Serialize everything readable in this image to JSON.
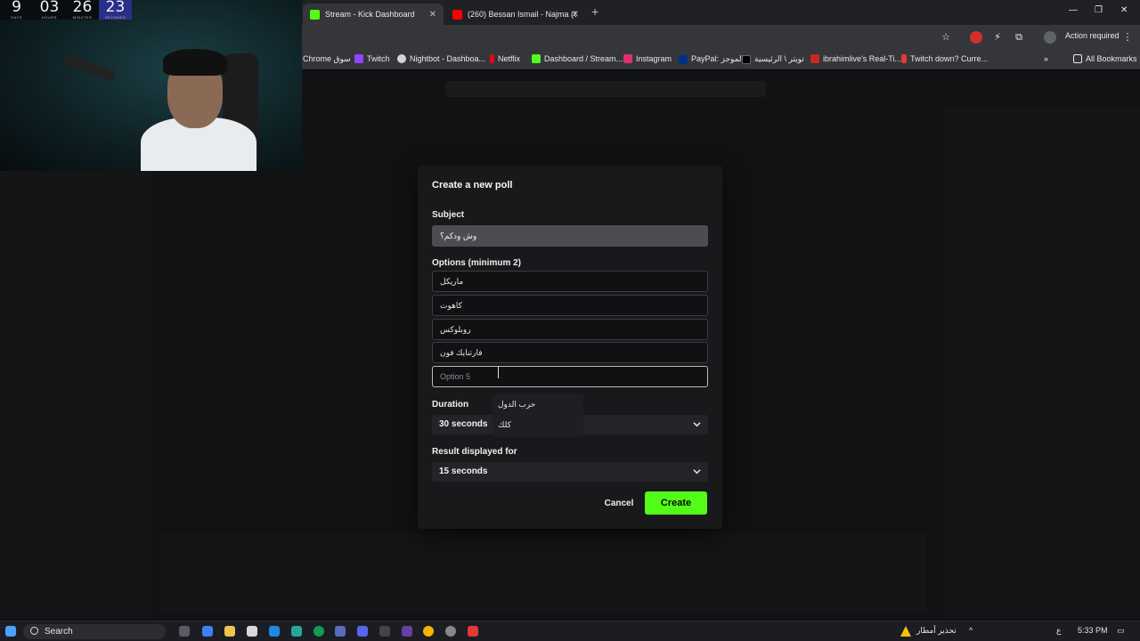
{
  "browser": {
    "tabs": [
      {
        "label": "Stream - Kick Dashboard",
        "favicon_color": "#53fc18",
        "active": true
      },
      {
        "label": "(260) Bessan Ismail - Najma (Of",
        "favicon_color": "#ff0000",
        "active": false
      }
    ],
    "action_required": "Action required",
    "bookmarks": [
      {
        "label": "Chrome سوق",
        "icon_color": ""
      },
      {
        "label": "Twitch",
        "icon_color": "#9146ff"
      },
      {
        "label": "Nightbot - Dashboa...",
        "icon_color": "#d5d5d5"
      },
      {
        "label": "Netflix",
        "icon_color": "#e50914"
      },
      {
        "label": "Dashboard / Stream...",
        "icon_color": "#53fc18"
      },
      {
        "label": "Instagram",
        "icon_color": "#e1306c"
      },
      {
        "label": "PayPal: الموجز",
        "icon_color": "#003087"
      },
      {
        "label": "تويتر \\ الرئيسية",
        "icon_color": "#000000"
      },
      {
        "label": "ibrahimlive's Real-Ti...",
        "icon_color": "#c62828"
      },
      {
        "label": "Twitch down? Curre...",
        "icon_color": "#e53935"
      }
    ],
    "all_bookmarks": "All Bookmarks",
    "more": "»"
  },
  "webcam": {
    "timer": [
      {
        "value": "9",
        "unit": "DAYS"
      },
      {
        "value": "03",
        "unit": "HOURS"
      },
      {
        "value": "26",
        "unit": "MINUTES"
      },
      {
        "value": "23",
        "unit": "SECONDS"
      }
    ]
  },
  "modal": {
    "title": "Create a new poll",
    "subject_label": "Subject",
    "subject_value": "وش ودكم؟",
    "options_label": "Options (minimum 2)",
    "options": [
      "ماريكل",
      "كاهوت",
      "روبلوكس",
      "فارتنايك فون"
    ],
    "option5_placeholder": "Option 5",
    "autocomplete": [
      "حرب الدول",
      "كلك"
    ],
    "duration_label": "Duration",
    "duration_value": "30 seconds",
    "result_label": "Result displayed for",
    "result_value": "15 seconds",
    "cancel": "Cancel",
    "create": "Create",
    "accent": "#53fc18"
  },
  "taskbar": {
    "search": "Search",
    "weather_text": "تحذير أمطار",
    "lang": "ع",
    "time": "5:33 PM"
  }
}
